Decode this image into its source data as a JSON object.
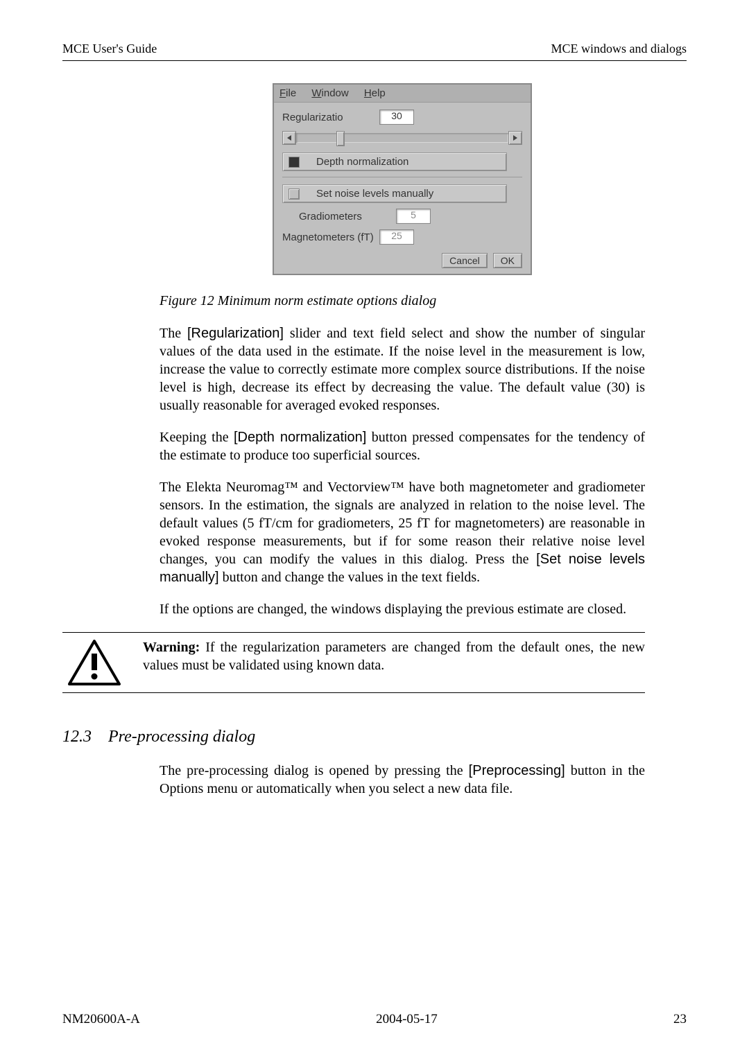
{
  "header": {
    "left": "MCE User's Guide",
    "right": "MCE windows and dialogs"
  },
  "dialog": {
    "menu": {
      "file": "File",
      "window": "Window",
      "help": "Help"
    },
    "regularization_label": "Regularizatio",
    "regularization_value": "30",
    "depth_norm_label": "Depth normalization",
    "set_noise_label": "Set noise levels manually",
    "gradiometers_label": "Gradiometers",
    "gradiometers_value": "5",
    "magnetometers_label": "Magnetometers (fT)",
    "magnetometers_value": "25",
    "cancel": "Cancel",
    "ok": "OK"
  },
  "caption": "Figure 12   Minimum norm estimate options dialog",
  "para1_a": "The ",
  "para1_b": "[Regularization]",
  "para1_c": " slider and text field select and show the number of singular values of the data used in the estimate. If the noise level in the measurement is low, increase the value to correctly estimate more complex source distributions. If the noise level is high, decrease its effect by decreasing the value. The default value (30) is usually reasonable for averaged evoked responses.",
  "para2_a": "Keeping the ",
  "para2_b": "[Depth normalization]",
  "para2_c": " button pressed compensates for the tendency of the estimate to produce too superficial sources.",
  "para3_a": "The Elekta Neuromag™ and Vectorview™ have both magnetometer and gradiometer sensors. In the estimation, the signals are analyzed in relation to the noise level. The default values (5 fT/cm for gradiometers, 25 fT for magnetometers) are reasonable in evoked response measurements, but if for some reason their relative noise level changes, you can modify the values in this dialog. Press the ",
  "para3_b": "[Set noise levels manually]",
  "para3_c": " button and change the values in the text fields.",
  "para4": "If the options are changed, the windows displaying the previous estimate are closed.",
  "warning_a": "Warning:",
  "warning_b": " If the regularization parameters are changed from the default ones, the new values must be validated using known data.",
  "section": {
    "num": "12.3",
    "title": "Pre-processing dialog"
  },
  "para5_a": "The pre-processing dialog is opened by pressing the ",
  "para5_b": "[Preprocessing]",
  "para5_c": " button in the Options menu or automatically when you select a new data file.",
  "footer": {
    "left": "NM20600A-A",
    "center": "2004-05-17",
    "right": "23"
  }
}
